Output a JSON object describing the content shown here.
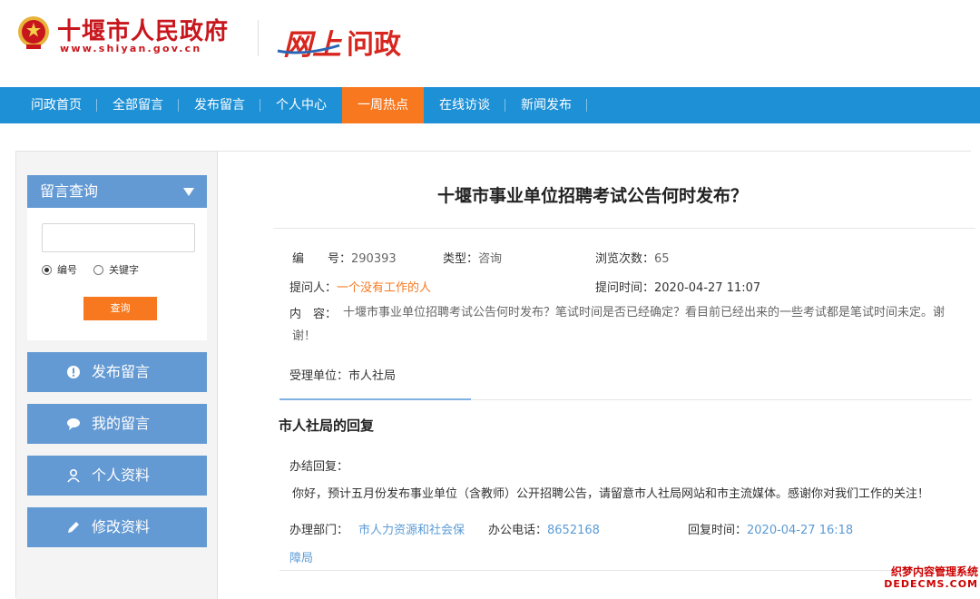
{
  "header": {
    "site_name": "十堰市人民政府",
    "site_url": "www.shiyan.gov.cn",
    "logo_part1": "网上",
    "logo_part2": "问政"
  },
  "nav": {
    "items": [
      {
        "label": "问政首页",
        "active": false
      },
      {
        "label": "全部留言",
        "active": false
      },
      {
        "label": "发布留言",
        "active": false
      },
      {
        "label": "个人中心",
        "active": false
      },
      {
        "label": "一周热点",
        "active": true
      },
      {
        "label": "在线访谈",
        "active": false
      },
      {
        "label": "新闻发布",
        "active": false
      }
    ]
  },
  "sidebar": {
    "query_title": "留言查询",
    "search_value": "",
    "radio_number": "编号",
    "radio_keyword": "关键字",
    "selected_radio": "编号",
    "query_button": "查询",
    "buttons": [
      {
        "label": "发布留言",
        "icon": "exclamation-icon"
      },
      {
        "label": "我的留言",
        "icon": "speech-bubble-icon"
      },
      {
        "label": "个人资料",
        "icon": "user-icon"
      },
      {
        "label": "修改资料",
        "icon": "pencil-icon"
      }
    ]
  },
  "message": {
    "title": "十堰市事业单位招聘考试公告何时发布？",
    "number_label": "编　　号：",
    "number": "290393",
    "type_label": "类型：",
    "type": "咨询",
    "views_label": "浏览次数：",
    "views": "65",
    "asker_label": "提问人：",
    "asker": "一个没有工作的人",
    "time_label": "提问时间：",
    "time": "2020-04-27 11:07",
    "content_label": "内　容：",
    "content": "十堰市事业单位招聘考试公告何时发布？笔试时间是否已经确定？看目前已经出来的一些考试都是笔试时间未定。谢谢！",
    "dept_label": "受理单位：",
    "dept": "市人社局"
  },
  "reply": {
    "title": "市人社局的回复",
    "status_label": "办结回复：",
    "text": "你好，预计五月份发布事业单位（含教师）公开招聘公告，请留意市人社局网站和市主流媒体。感谢你对我们工作的关注！",
    "dept_label": "办理部门：",
    "dept_line1": "市人力资源和社会保",
    "dept_line2": "障局",
    "phone_label": "办公电话：",
    "phone": "8652168",
    "time_label": "回复时间：",
    "time": "2020-04-27 16:18"
  },
  "watermark": {
    "line1": "织梦内容管理系统",
    "line2": "DEDECMS.COM"
  },
  "colors": {
    "nav_blue": "#1e90d6",
    "active_orange": "#f7781f",
    "side_blue": "#649ad4",
    "gov_red": "#c8161d"
  }
}
